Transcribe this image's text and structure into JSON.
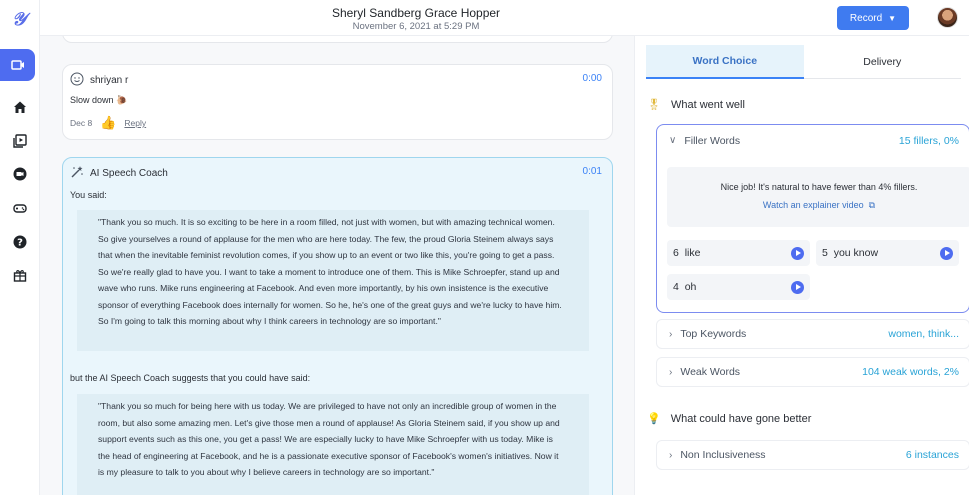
{
  "header": {
    "title": "Sheryl Sandberg Grace Hopper",
    "subtitle": "November 6, 2021 at 5:29 PM",
    "record_label": "Record"
  },
  "rail": {
    "items": [
      "video-icon",
      "home-icon",
      "library-icon",
      "camera-icon",
      "gamepad-icon",
      "help-icon",
      "gift-icon"
    ],
    "active": "video-icon"
  },
  "comment": {
    "author": "shriyan r",
    "time": "0:00",
    "text": "Slow down 🐌",
    "date": "Dec 8",
    "reply": "Reply"
  },
  "coach": {
    "author": "AI Speech Coach",
    "time": "0:01",
    "you_said": "You said:",
    "original": "\"Thank you so much. It is so exciting to be here in a room filled, not just with women, but with amazing technical women. So give yourselves a round of applause for the men who are here today. The few, the proud Gloria Steinem always says that when the inevitable feminist revolution comes, if you show up to an event or two like this, you're going to get a pass. So we're really glad to have you. I want to take a moment to introduce one of them. This is Mike Schroepfer, stand up and wave who runs. Mike runs engineering at Facebook. And even more importantly, by his own insistence is the executive sponsor of everything Facebook does internally for women. So he, he's one of the great guys and we're lucky to have him. So I'm going to talk this morning about why I think careers in technology are so important.\"",
    "suggest_label": "but the AI Speech Coach suggests that you could have said:",
    "suggested": "\"Thank you so much for being here with us today. We are privileged to have not only an incredible group of women in the room, but also some amazing men. Let's give those men a round of applause! As Gloria Steinem said, if you show up and support events such as this one, you get a pass! We are especially lucky to have Mike Schroepfer with us today. Mike is the head of engineering at Facebook, and he is a passionate executive sponsor of Facebook's women's initiatives. Now it is my pleasure to talk to you about why I believe careers in technology are so important.\""
  },
  "panel": {
    "tabs": [
      "Word Choice",
      "Delivery"
    ],
    "active_tab": "Word Choice",
    "went_well": "What went well",
    "could_better": "What could have gone better",
    "filler": {
      "name": "Filler Words",
      "value": "15 fillers, 0%",
      "message": "Nice job! It's natural to have fewer than 4% fillers.",
      "link": "Watch an explainer video",
      "chips": [
        {
          "count": "6",
          "word": "like"
        },
        {
          "count": "5",
          "word": "you know"
        },
        {
          "count": "4",
          "word": "oh"
        }
      ]
    },
    "top_keywords": {
      "name": "Top Keywords",
      "value": "women, think..."
    },
    "weak_words": {
      "name": "Weak Words",
      "value": "104 weak words, 2%"
    },
    "non_inclusive": {
      "name": "Non Inclusiveness",
      "value": "6 instances"
    }
  }
}
